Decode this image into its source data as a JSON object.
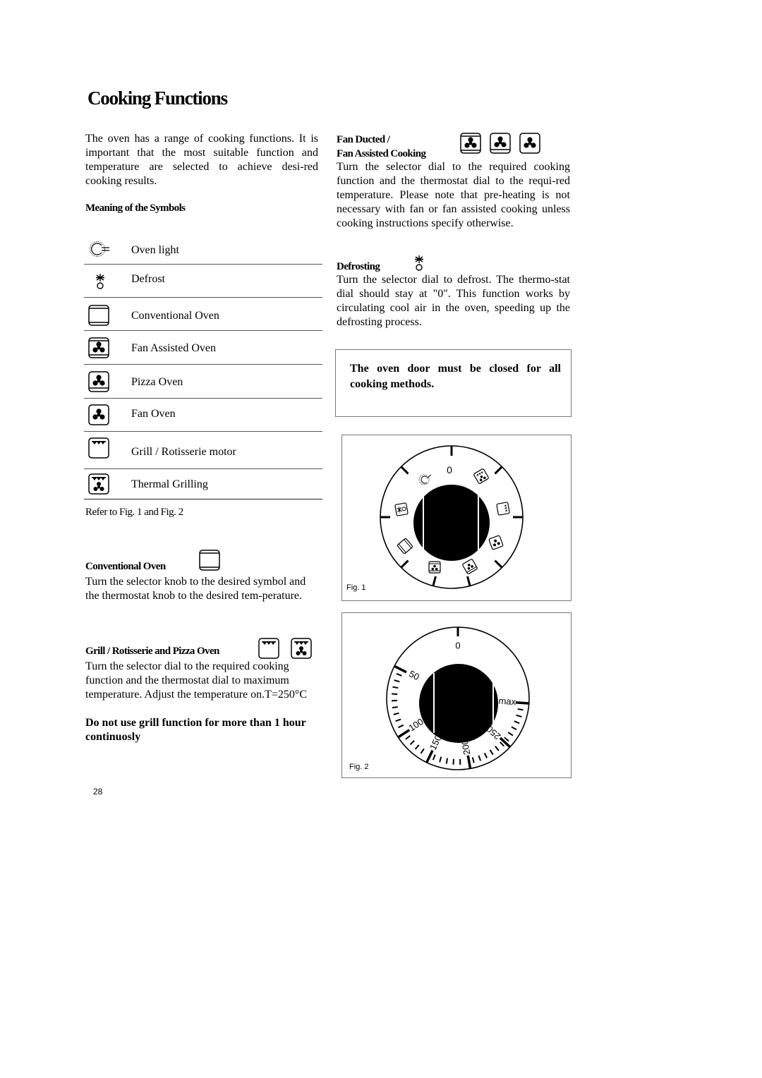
{
  "page": {
    "title": "Cooking Functions",
    "intro": "The oven has a range of cooking functions. It is important that the most suitable function and temperature are selected to achieve desi-red cooking results.",
    "page_number": "28"
  },
  "symbols": {
    "heading": "Meaning of the Symbols",
    "items": [
      {
        "icon": "oven-light-icon",
        "label": "Oven light"
      },
      {
        "icon": "defrost-icon",
        "label": "Defrost"
      },
      {
        "icon": "conventional-oven-icon",
        "label": "Conventional Oven"
      },
      {
        "icon": "fan-assisted-oven-icon",
        "label": "Fan Assisted Oven"
      },
      {
        "icon": "pizza-oven-icon",
        "label": "Pizza Oven"
      },
      {
        "icon": "fan-oven-icon",
        "label": "Fan Oven"
      },
      {
        "icon": "grill-rotisserie-icon",
        "label": "Grill / Rotisserie motor"
      },
      {
        "icon": "thermal-grilling-icon",
        "label": "Thermal Grilling"
      }
    ],
    "refer": "Refer to Fig. 1 and Fig. 2"
  },
  "sections": {
    "conventional": {
      "heading": "Conventional Oven",
      "body": "Turn the selector knob to the desired symbol and the thermostat knob to the desired tem-perature."
    },
    "grill": {
      "heading": "Grill / Rotisserie and Pizza Oven",
      "body": "Turn the selector dial to the required cooking function and the thermostat dial to maximum temperature. Adjust the temperature on.T=250°C",
      "warning": "Do not use grill function for more than 1 hour continuosly"
    },
    "fan": {
      "heading_line1": "Fan Ducted /",
      "heading_line2": "Fan Assisted Cooking",
      "body": "Turn the selector dial to the required cooking function and the thermostat dial to the requi-red temperature. Please note that pre-heating is not necessary with fan or fan assisted cooking unless cooking instructions specify otherwise."
    },
    "defrosting": {
      "heading": "Defrosting",
      "body": "Turn the selector dial to defrost. The thermo-stat dial should stay at \"0\". This function works by circulating cool air in the oven, speeding up the defrosting process."
    },
    "notice": "The oven door must be closed for all cooking methods."
  },
  "figures": {
    "fig1": {
      "label": "Fig. 1",
      "zero_label": "0",
      "positions": [
        "off",
        "oven-light",
        "defrost",
        "conventional-oven",
        "fan-assisted-oven",
        "pizza-oven",
        "fan-oven",
        "grill",
        "thermal-grilling"
      ]
    },
    "fig2": {
      "label": "Fig. 2",
      "scale_labels": [
        "0",
        "50",
        "100",
        "150",
        "200",
        "250",
        "max"
      ]
    }
  }
}
